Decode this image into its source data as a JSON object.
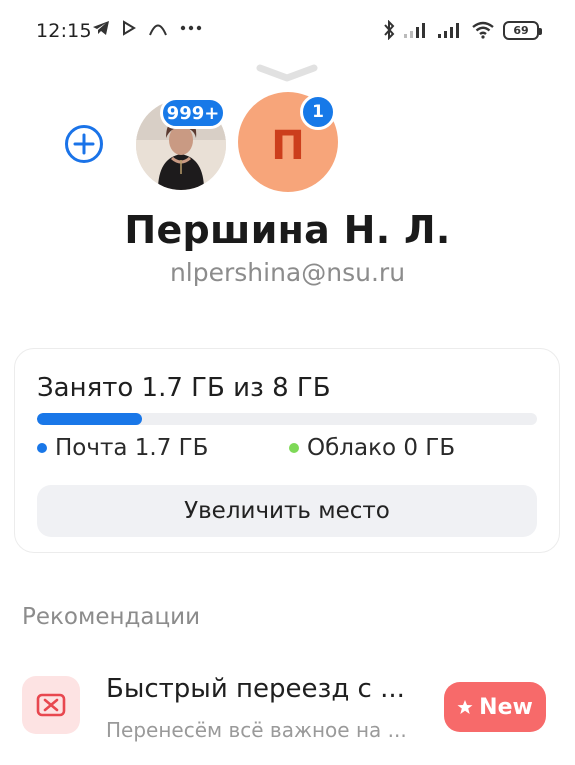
{
  "status_bar": {
    "time": "12:15",
    "left_icons": [
      "telegram-icon",
      "play-icon",
      "arc-icon",
      "more-dots-icon"
    ],
    "right_icons": [
      "bluetooth-icon",
      "signal-icon",
      "signal-icon",
      "wifi-icon"
    ],
    "battery": "69"
  },
  "account": {
    "badge_photo": "999+",
    "badge_letter": "1",
    "letter": "П",
    "name": "Першина Н. Л.",
    "email": "nlpershina@nsu.ru"
  },
  "storage": {
    "title": "Занято 1.7 ГБ из 8 ГБ",
    "used_fraction": 0.21,
    "mail_label": "Почта 1.7 ГБ",
    "cloud_label": "Облако 0 ГБ",
    "increase_button": "Увеличить место",
    "colors": {
      "mail": "#1977e8",
      "cloud": "#7ed957",
      "track": "#eeeff2"
    }
  },
  "recommendations": {
    "title": "Рекомендации",
    "items": [
      {
        "title": "Быстрый переезд с ...",
        "subtitle": "Перенесём всё важное на ...",
        "badge": "New",
        "icon": "mail-cross-icon"
      }
    ]
  }
}
